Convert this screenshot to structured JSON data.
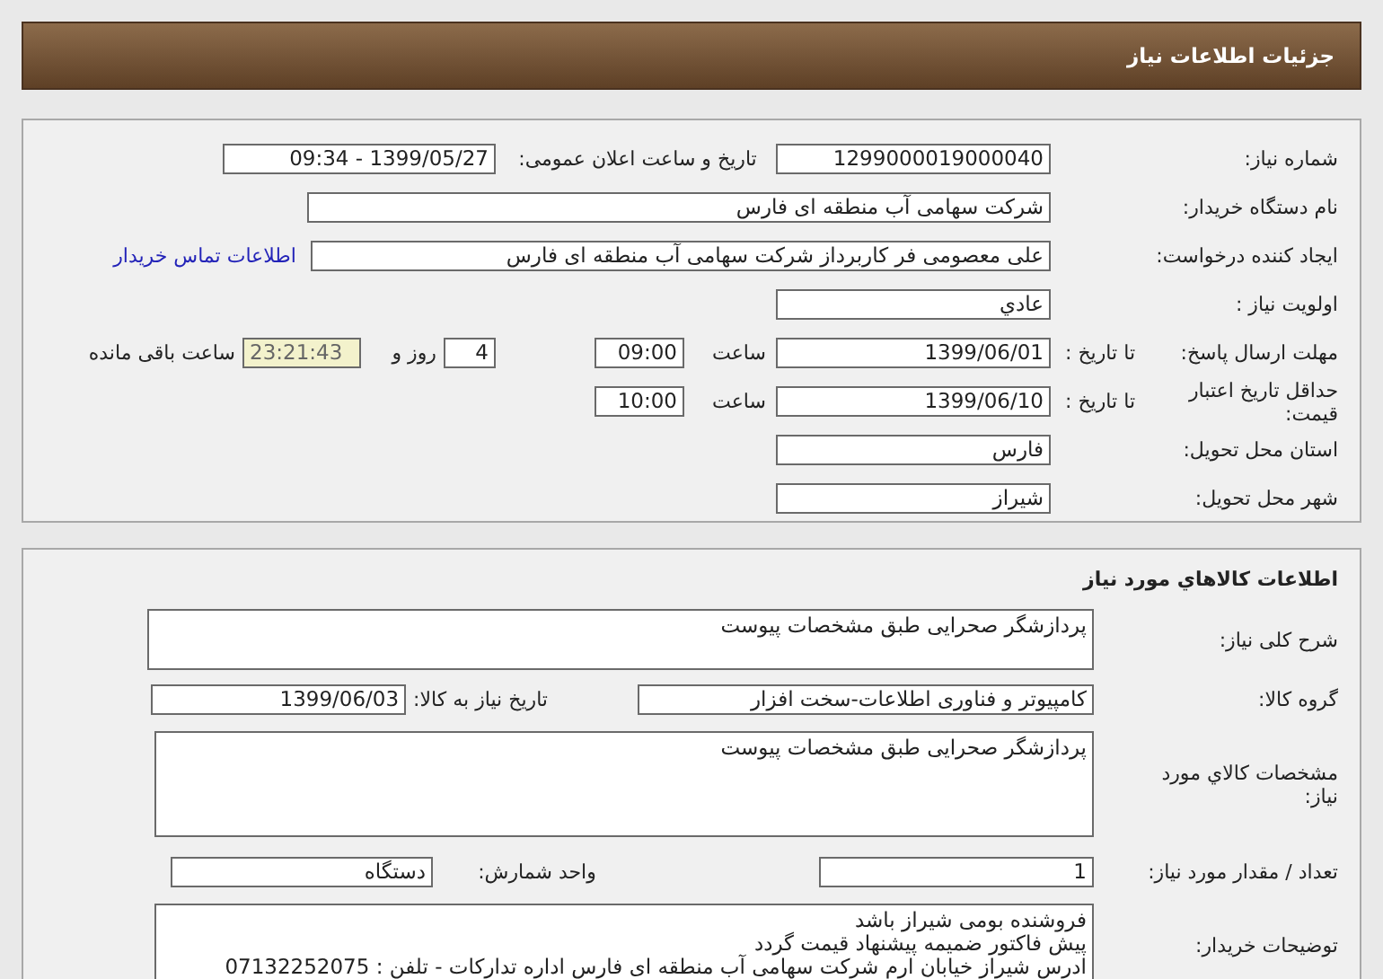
{
  "header": {
    "title": "جزئیات اطلاعات نیاز"
  },
  "need_info": {
    "rows": [
      {
        "label": "شماره نیاز:",
        "items": [
          {
            "kind": "field",
            "value": "1299000019000040"
          },
          {
            "kind": "text",
            "value": "تاریخ و ساعت اعلان عمومی:"
          },
          {
            "kind": "field",
            "value": "1399/05/27 - 09:34"
          }
        ]
      },
      {
        "label": "نام دستگاه خریدار:",
        "items": [
          {
            "kind": "field",
            "value": "شرکت سهامی آب منطقه ای فارس"
          }
        ]
      },
      {
        "label": "ایجاد کننده درخواست:",
        "items": [
          {
            "kind": "field",
            "value": "علی معصومی فر کاربرداز شرکت سهامی آب منطقه ای فارس"
          },
          {
            "kind": "link",
            "value": "اطلاعات تماس خریدار"
          }
        ]
      },
      {
        "label": "اولویت نیاز :",
        "items": [
          {
            "kind": "field",
            "value": "عادي"
          }
        ]
      },
      {
        "label": "مهلت ارسال پاسخ:",
        "sublabel": "تا تاریخ :",
        "items": [
          {
            "kind": "field",
            "value": "1399/06/01"
          },
          {
            "kind": "text",
            "value": "ساعت"
          },
          {
            "kind": "field",
            "value": "09:00"
          },
          {
            "kind": "field",
            "value": "4"
          },
          {
            "kind": "text",
            "value": "روز و"
          },
          {
            "kind": "timer",
            "value": "23:21:43"
          },
          {
            "kind": "text",
            "value": "ساعت باقی مانده"
          }
        ]
      },
      {
        "label": "حداقل تاریخ اعتبار قیمت:",
        "sublabel": "تا تاریخ :",
        "items": [
          {
            "kind": "field",
            "value": "1399/06/10"
          },
          {
            "kind": "text",
            "value": "ساعت"
          },
          {
            "kind": "field",
            "value": "10:00"
          }
        ]
      },
      {
        "label": "استان محل تحویل:",
        "items": [
          {
            "kind": "field",
            "value": "فارس"
          }
        ]
      },
      {
        "label": "شهر محل تحویل:",
        "items": [
          {
            "kind": "field",
            "value": "شیراز"
          }
        ]
      }
    ]
  },
  "goods_info": {
    "title": "اطلاعات کالاهاي مورد نیاز",
    "rows": [
      {
        "label": "شرح کلی نیاز:",
        "items": [
          {
            "kind": "memo",
            "lines": [
              "پردازشگر صحرایی طبق مشخصات پیوست"
            ]
          }
        ]
      },
      {
        "label": "گروه کالا:",
        "items": [
          {
            "kind": "field",
            "value": "کامپیوتر و فناوری اطلاعات-سخت افزار"
          },
          {
            "kind": "text",
            "value": "تاریخ نیاز به کالا:"
          },
          {
            "kind": "field",
            "value": "1399/06/03"
          }
        ]
      },
      {
        "label": "مشخصات کالاي مورد نیاز:",
        "items": [
          {
            "kind": "memo",
            "lines": [
              "پردازشگر صحرایی طبق مشخصات پیوست"
            ]
          }
        ]
      },
      {
        "label": "تعداد / مقدار مورد نیاز:",
        "items": [
          {
            "kind": "field",
            "value": "1"
          },
          {
            "kind": "text",
            "value": "واحد شمارش:"
          },
          {
            "kind": "field",
            "value": "دستگاه"
          }
        ]
      },
      {
        "label": "توضیحات خریدار:",
        "items": [
          {
            "kind": "memo",
            "lines": [
              "فروشنده بومی شیراز باشد",
              "پیش فاکتور ضمیمه پیشنهاد قیمت گردد",
              "ادرس شیراز خیابان ارم شرکت سهامی آب منطقه ای فارس اداره تدارکات - تلفن : 07132252075"
            ]
          }
        ]
      }
    ]
  }
}
